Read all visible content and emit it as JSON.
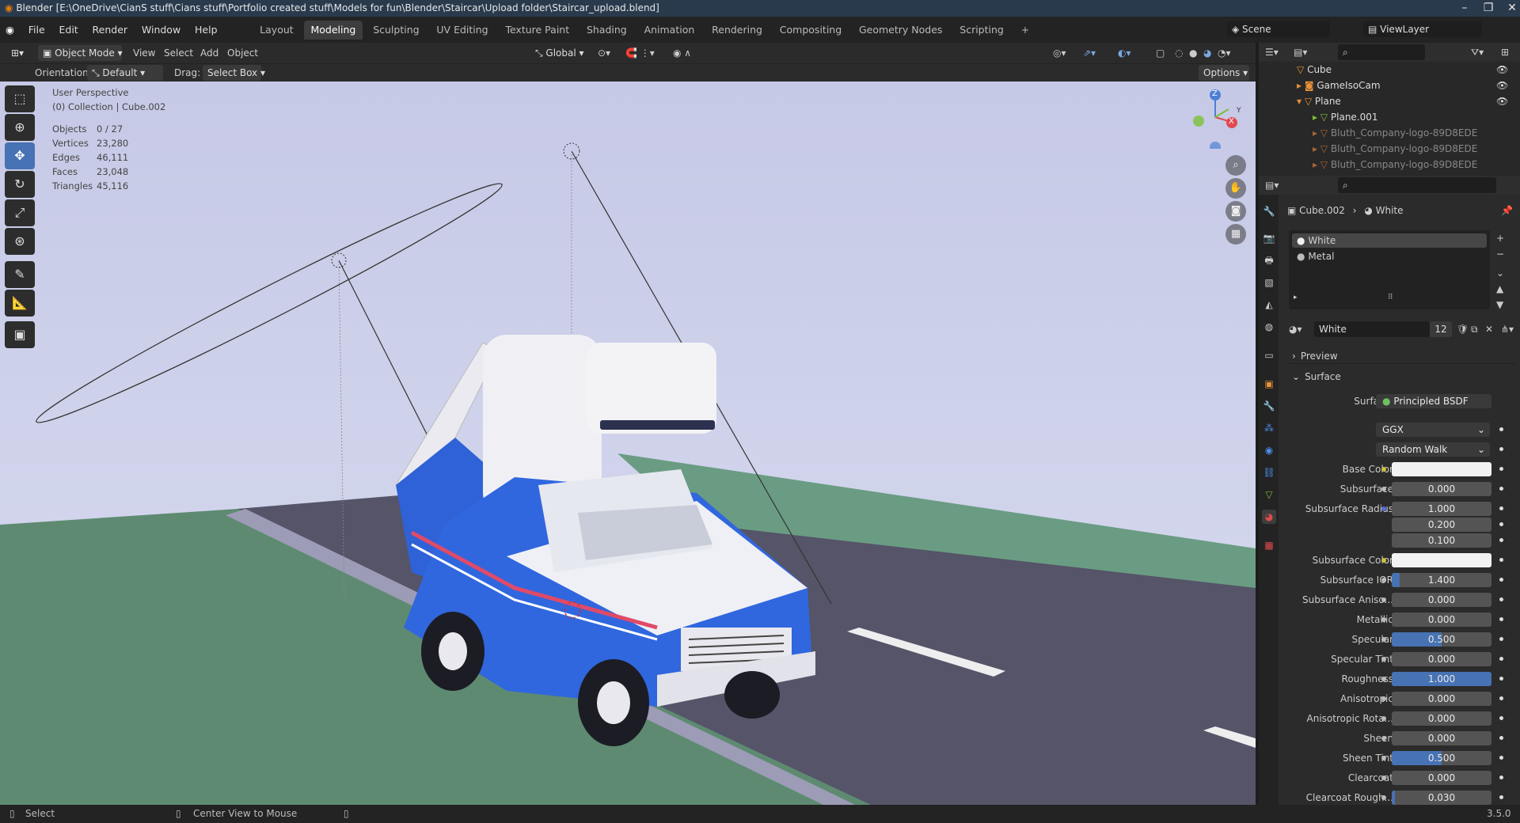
{
  "window": {
    "title": "Blender [E:\\OneDrive\\CianS stuff\\Cians stuff\\Portfolio created stuff\\Models for fun\\Blender\\Staircar\\Upload folder\\Staircar_upload.blend]",
    "minimize": "–",
    "maximize": "❐",
    "close": "✕"
  },
  "menu": [
    "File",
    "Edit",
    "Render",
    "Window",
    "Help"
  ],
  "workspaces": [
    "Layout",
    "Modeling",
    "Sculpting",
    "UV Editing",
    "Texture Paint",
    "Shading",
    "Animation",
    "Rendering",
    "Compositing",
    "Geometry Nodes",
    "Scripting",
    "+"
  ],
  "active_workspace": "Modeling",
  "scene": {
    "label": "Scene",
    "view_layer": "ViewLayer"
  },
  "header": {
    "mode": "Object Mode",
    "menus": [
      "View",
      "Select",
      "Add",
      "Object"
    ],
    "transform_orientation": "Global"
  },
  "tool_settings": {
    "orientation_label": "Orientation:",
    "orientation_value": "Default",
    "drag_label": "Drag:",
    "drag_value": "Select Box",
    "options": "Options"
  },
  "viewport": {
    "perspective": "User Perspective",
    "collection": "(0) Collection | Cube.002",
    "stats": [
      {
        "k": "Objects",
        "v": "0 / 27"
      },
      {
        "k": "Vertices",
        "v": "23,280"
      },
      {
        "k": "Edges",
        "v": "46,111"
      },
      {
        "k": "Faces",
        "v": "23,048"
      },
      {
        "k": "Triangles",
        "v": "45,116"
      }
    ],
    "axis_z": "Z",
    "axis_x": "X",
    "axis_y": "Y"
  },
  "outliner": [
    {
      "name": "Cube",
      "indent": 0
    },
    {
      "name": "GameIsoCam",
      "indent": 0
    },
    {
      "name": "Plane",
      "indent": 0
    },
    {
      "name": "Plane.001",
      "indent": 1
    },
    {
      "name": "Bluth_Company-logo-89D8EDE",
      "indent": 1
    },
    {
      "name": "Bluth_Company-logo-89D8EDE",
      "indent": 1
    },
    {
      "name": "Bluth_Company-logo-89D8EDE",
      "indent": 1
    }
  ],
  "properties": {
    "breadcrumb_object": "Cube.002",
    "breadcrumb_material": "White",
    "slots": [
      "White",
      "Metal"
    ],
    "material_name": "White",
    "users": "12",
    "panels": {
      "preview": "Preview",
      "surface": "Surface"
    },
    "surface_label": "Surface",
    "surface_shader": "Principled BSDF",
    "distribution": "GGX",
    "subsurface_method": "Random Walk",
    "fields": [
      {
        "label": "Base Color",
        "value": "",
        "kind": "color",
        "color": "#f2f2f2"
      },
      {
        "label": "Subsurface",
        "value": "0.000",
        "fill": 0
      },
      {
        "label": "Subsurface Radius",
        "value": "1.000",
        "fill": 0
      },
      {
        "label": "",
        "value": "0.200",
        "fill": 0
      },
      {
        "label": "",
        "value": "0.100",
        "fill": 0
      },
      {
        "label": "Subsurface Color",
        "value": "",
        "kind": "color",
        "color": "#f2f2f2"
      },
      {
        "label": "Subsurface IOR",
        "value": "1.400",
        "fill": 0.08
      },
      {
        "label": "Subsurface Aniso...",
        "value": "0.000",
        "fill": 0
      },
      {
        "label": "Metallic",
        "value": "0.000",
        "fill": 0
      },
      {
        "label": "Specular",
        "value": "0.500",
        "fill": 0.5
      },
      {
        "label": "Specular Tint",
        "value": "0.000",
        "fill": 0
      },
      {
        "label": "Roughness",
        "value": "1.000",
        "fill": 1
      },
      {
        "label": "Anisotropic",
        "value": "0.000",
        "fill": 0
      },
      {
        "label": "Anisotropic Rota...",
        "value": "0.000",
        "fill": 0
      },
      {
        "label": "Sheen",
        "value": "0.000",
        "fill": 0
      },
      {
        "label": "Sheen Tint",
        "value": "0.500",
        "fill": 0.5
      },
      {
        "label": "Clearcoat",
        "value": "0.000",
        "fill": 0
      },
      {
        "label": "Clearcoat Rough...",
        "value": "0.030",
        "fill": 0.03
      }
    ]
  },
  "statusbar": {
    "left": "Select",
    "middle": "Center View to Mouse",
    "version": "3.5.0"
  }
}
